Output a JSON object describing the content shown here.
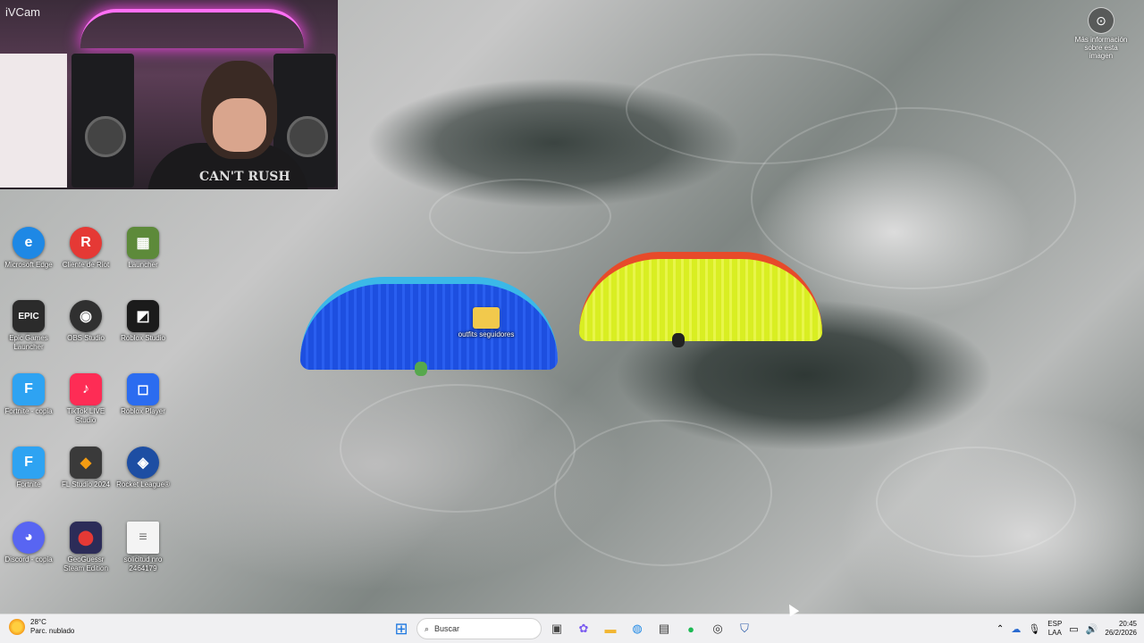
{
  "webcam": {
    "label": "iVCam",
    "shirt_text": "CAN'T RUSH"
  },
  "desktop_icons": [
    {
      "label": "Microsoft Edge",
      "glyph": "e",
      "color": "#1e88e5"
    },
    {
      "label": "Cliente de Riot",
      "glyph": "R",
      "color": "#e53935"
    },
    {
      "label": "Launcher",
      "glyph": "▦",
      "color": "#5d8a3a"
    },
    {
      "label": "Epic Games Launcher",
      "glyph": "EPIC",
      "color": "#2b2b2b"
    },
    {
      "label": "OBS Studio",
      "glyph": "◉",
      "color": "#303030"
    },
    {
      "label": "Roblox Studio",
      "glyph": "◩",
      "color": "#1b1b1b"
    },
    {
      "label": "Fortnite - copia",
      "glyph": "F",
      "color": "#2ea3f2"
    },
    {
      "label": "TikTok LIVE Studio",
      "glyph": "♪",
      "color": "#fe2c55"
    },
    {
      "label": "Roblox Player",
      "glyph": "◻",
      "color": "#2b6cf0"
    },
    {
      "label": "Fortnite",
      "glyph": "F",
      "color": "#2ea3f2"
    },
    {
      "label": "FL Studio 2024",
      "glyph": "◆",
      "color": "#f39c12"
    },
    {
      "label": "Rocket League®",
      "glyph": "◈",
      "color": "#1d4ea3"
    },
    {
      "label": "Discord - copia",
      "glyph": "◕",
      "color": "#5865f2"
    },
    {
      "label": "GeoGuessr Steam Edition",
      "glyph": "⬤",
      "color": "#2c2c58"
    },
    {
      "label": "solicitud nro 2464179",
      "glyph": "≡",
      "color": "#f4f4f4"
    }
  ],
  "folder": {
    "label": "outfits seguidores"
  },
  "info_button": {
    "label": "Más información sobre esta imagen",
    "icon": "camera-icon"
  },
  "taskbar": {
    "weather_temp": "28°C",
    "weather_desc": "Parc. nublado",
    "search_placeholder": "Buscar",
    "lang_top": "ESP",
    "lang_bottom": "LAA",
    "time": "20:45",
    "date": "26/2/2026"
  }
}
